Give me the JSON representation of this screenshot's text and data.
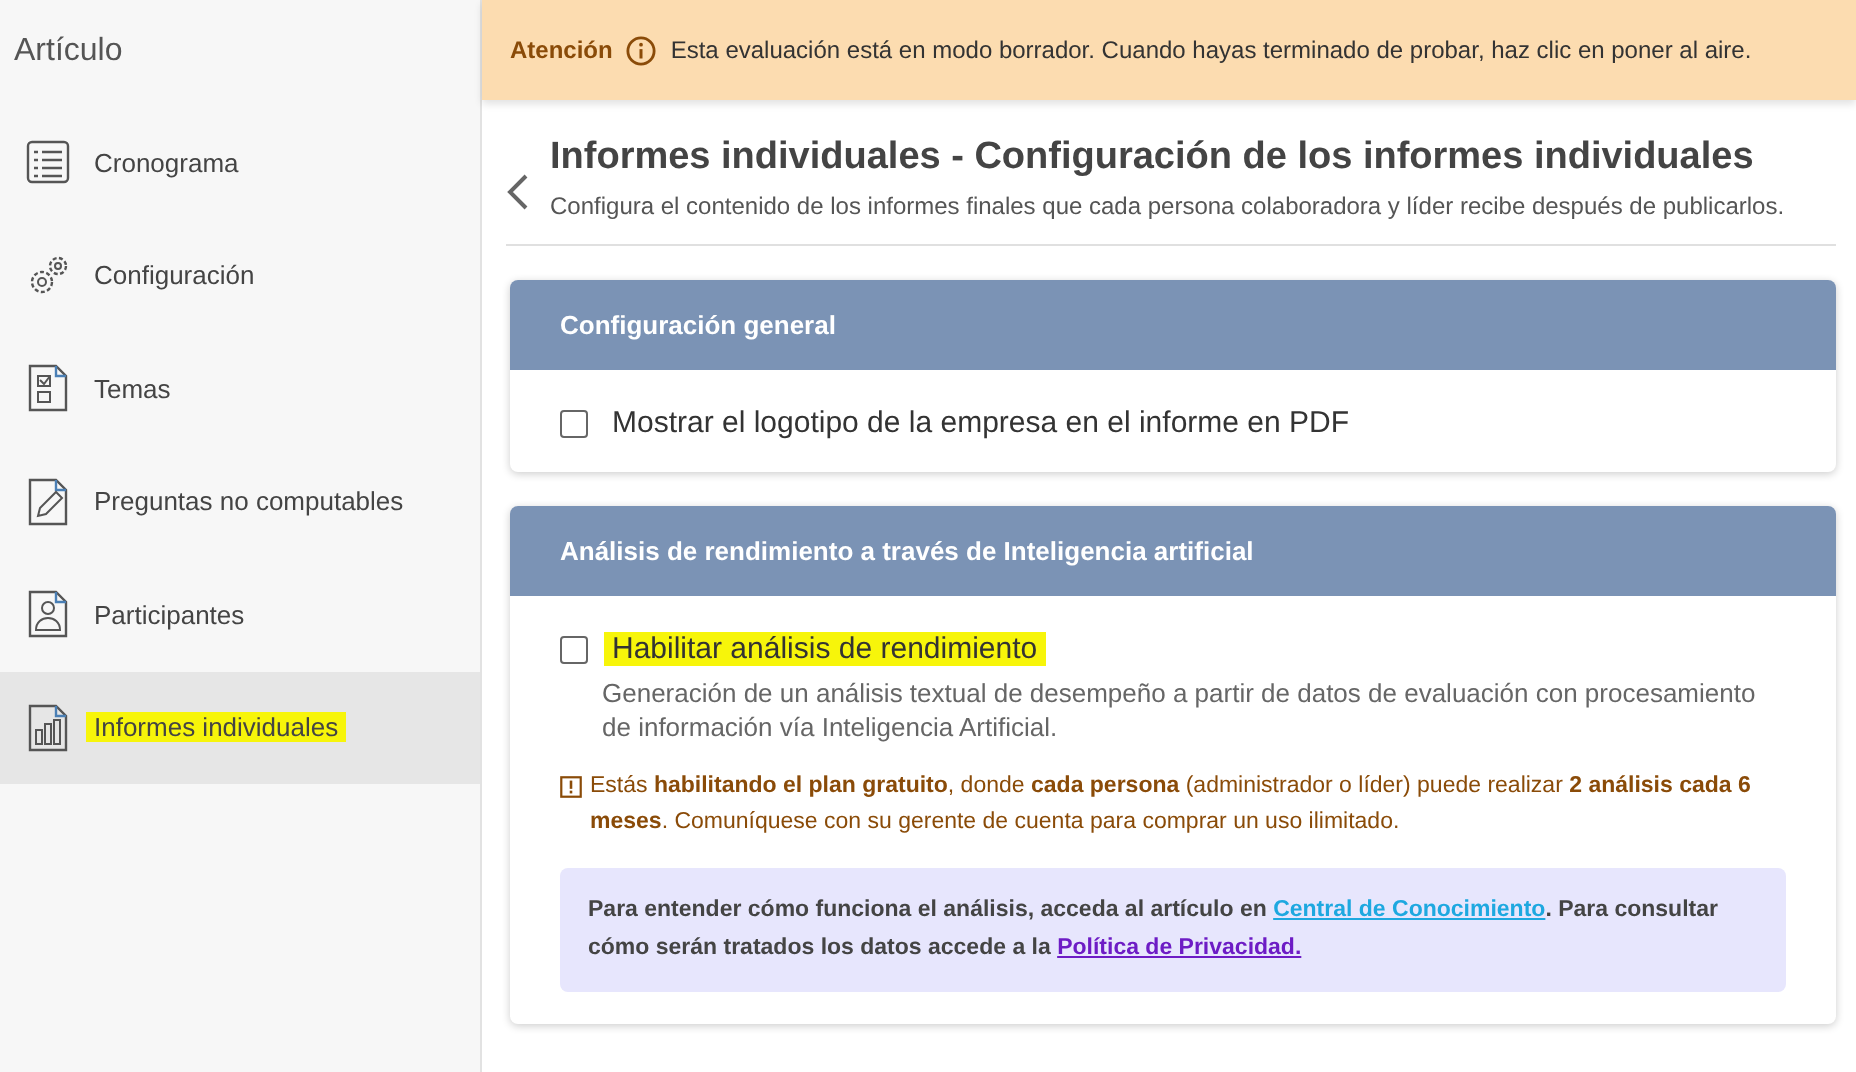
{
  "sidebar": {
    "title": "Artículo",
    "items": [
      {
        "label": "Cronograma",
        "selected": false,
        "highlighted": false
      },
      {
        "label": "Configuración",
        "selected": false,
        "highlighted": false
      },
      {
        "label": "Temas",
        "selected": false,
        "highlighted": false
      },
      {
        "label": "Preguntas no computables",
        "selected": false,
        "highlighted": false
      },
      {
        "label": "Participantes",
        "selected": false,
        "highlighted": false
      },
      {
        "label": "Informes individuales",
        "selected": true,
        "highlighted": true
      }
    ]
  },
  "banner": {
    "label": "Atención",
    "message": "Esta evaluación está en modo borrador. Cuando hayas terminado de probar, haz clic en poner al aire."
  },
  "header": {
    "title": "Informes individuales - Configuración de los informes individuales",
    "subtitle": "Configura el contenido de los informes finales que cada persona colaboradora y líder recibe después de publicarlos."
  },
  "sections": [
    {
      "title": "Configuración general",
      "options": [
        {
          "label": "Mostrar el logotipo de la empresa en el informe en PDF",
          "checked": false,
          "highlighted": false
        }
      ]
    },
    {
      "title": "Análisis de rendimiento a través de Inteligencia artificial",
      "options": [
        {
          "label": "Habilitar análisis de rendimiento",
          "checked": false,
          "highlighted": true,
          "description": "Generación de un análisis textual de desempeño a partir de datos de evaluación con procesamiento de información vía Inteligencia Artificial."
        }
      ],
      "warning": "Estás **habilitando el plan gratuito**, donde **cada persona** (administrador o líder) puede realizar **2 análisis cada 6 meses**. Comuníquese con su gerente de cuenta para comprar un uso ilimitado.",
      "info": {
        "text_1": "Para entender cómo funciona el análisis, acceda al artículo en ",
        "link_1": "Central de Conocimiento",
        "text_2": ". Para consultar cómo serán tratados los datos accede a la ",
        "link_2": "Política de Privacidad."
      }
    }
  ]
}
